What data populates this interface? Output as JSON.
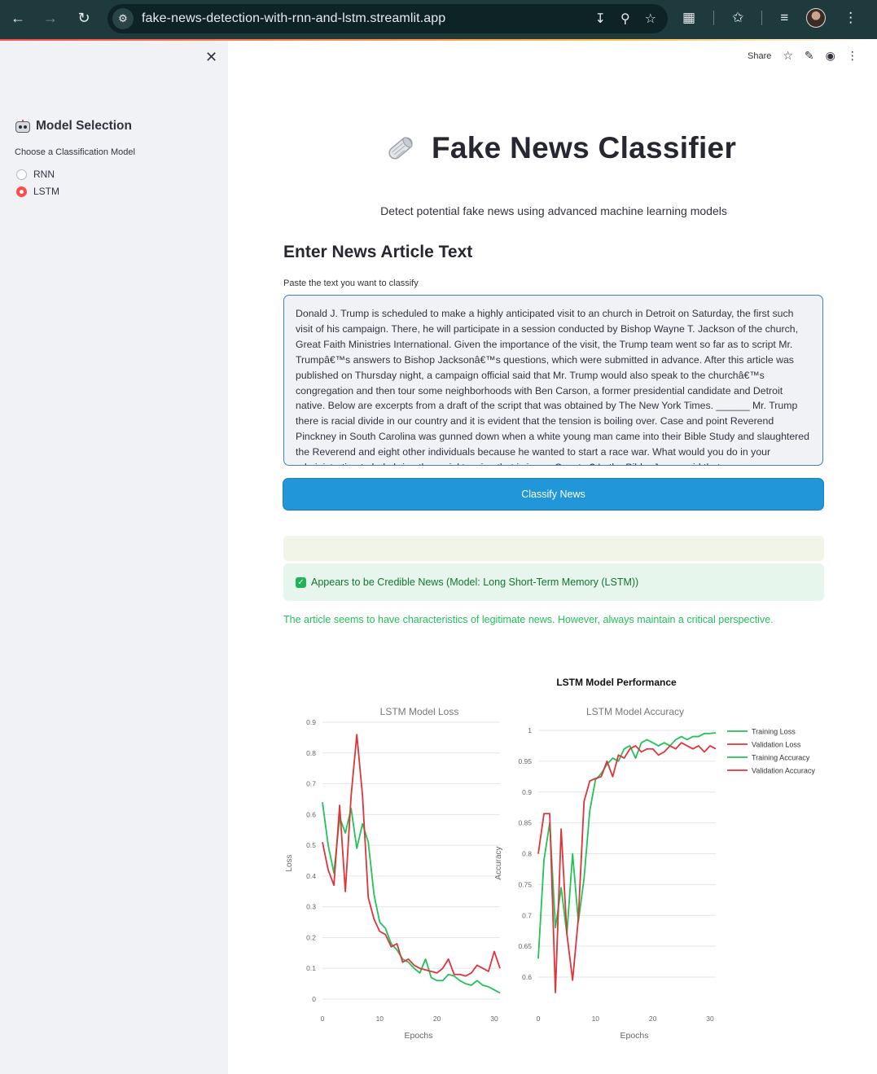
{
  "browser": {
    "url": "fake-news-detection-with-rnn-and-lstm.streamlit.app"
  },
  "toolbar": {
    "share_label": "Share"
  },
  "sidebar": {
    "title": "Model Selection",
    "radio_label": "Choose a Classification Model",
    "options": [
      {
        "label": "RNN",
        "selected": false
      },
      {
        "label": "LSTM",
        "selected": true
      }
    ]
  },
  "main": {
    "title": "Fake News Classifier",
    "subtitle": "Detect potential fake news using advanced machine learning models",
    "section_heading": "Enter News Article Text",
    "input_label": "Paste the text you want to classify",
    "article_text": "Donald J. Trump is scheduled to make a highly anticipated visit to an   church in Detroit on Saturday, the first such visit of his campaign. There, he will participate in a   session conducted by Bishop Wayne T. Jackson of the church, Great Faith Ministries International. Given the importance of the visit, the Trump team went so far as to script Mr. Trumpâ€™s answers to Bishop Jacksonâ€™s questions, which were submitted in advance. After this article was published on Thursday night, a campaign official said that Mr. Trump would also speak to the churchâ€™s congregation and then tour some neighborhoods with Ben Carson, a former presidential candidate and Detroit native. Below are excerpts from a draft of the script that was obtained by The New York Times. ______ Mr. Trump there is racial divide in our country and it is evident that the tension is boiling over. Case and point Reverend Pinckney in South Carolina was gunned down when a white young man came into their Bible Study and slaughtered the Reverend and eight other individuals because he wanted to start a race war. What would you do in your administration to help bring the racial tension that is in our Country? In the Bible, Jesus said that...",
    "classify_button": "Classify News",
    "result_label": "Appears to be Credible News (Model: Long Short-Term Memory (LSTM))",
    "result_note": "The article seems to have characteristics of legitimate news. However, always maintain a critical perspective."
  },
  "colors": {
    "train": "#21c35a",
    "val": "#e0343c",
    "accent": "#ff4b4b",
    "button": "#2196d8"
  },
  "chart_data": [
    {
      "type": "line",
      "suptitle": "LSTM Model Performance",
      "title": "LSTM Model Loss",
      "xlabel": "Epochs",
      "ylabel": "Loss",
      "xlim": [
        0,
        31
      ],
      "ylim": [
        0,
        0.9
      ],
      "yticks": [
        "0",
        "0.1",
        "0.2",
        "0.3",
        "0.4",
        "0.5",
        "0.6",
        "0.7",
        "0.8",
        "0.9"
      ],
      "xticks": [
        "0",
        "10",
        "20",
        "30"
      ],
      "x": [
        0,
        1,
        2,
        3,
        4,
        5,
        6,
        7,
        8,
        9,
        10,
        11,
        12,
        13,
        14,
        15,
        16,
        17,
        18,
        19,
        20,
        21,
        22,
        23,
        24,
        25,
        26,
        27,
        28,
        29,
        30,
        31
      ],
      "series": [
        {
          "name": "Training Loss",
          "values": [
            0.64,
            0.5,
            0.41,
            0.59,
            0.54,
            0.62,
            0.49,
            0.57,
            0.51,
            0.34,
            0.25,
            0.23,
            0.18,
            0.16,
            0.13,
            0.12,
            0.1,
            0.085,
            0.13,
            0.07,
            0.06,
            0.06,
            0.08,
            0.075,
            0.06,
            0.05,
            0.045,
            0.06,
            0.045,
            0.04,
            0.03,
            0.02
          ]
        },
        {
          "name": "Validation Loss",
          "values": [
            0.51,
            0.42,
            0.37,
            0.63,
            0.35,
            0.66,
            0.86,
            0.66,
            0.33,
            0.26,
            0.22,
            0.21,
            0.17,
            0.18,
            0.12,
            0.13,
            0.11,
            0.1,
            0.095,
            0.09,
            0.085,
            0.1,
            0.13,
            0.08,
            0.08,
            0.075,
            0.085,
            0.11,
            0.1,
            0.09,
            0.155,
            0.1
          ]
        }
      ]
    },
    {
      "type": "line",
      "title": "LSTM Model Accuracy",
      "xlabel": "Epochs",
      "ylabel": "Accuracy",
      "xlim": [
        0,
        31
      ],
      "ylim": [
        0.6,
        1.0
      ],
      "yticks": [
        "0.6",
        "0.65",
        "0.7",
        "0.75",
        "0.8",
        "0.85",
        "0.9",
        "0.95",
        "1"
      ],
      "xticks": [
        "0",
        "10",
        "20",
        "30"
      ],
      "x": [
        0,
        1,
        2,
        3,
        4,
        5,
        6,
        7,
        8,
        9,
        10,
        11,
        12,
        13,
        14,
        15,
        16,
        17,
        18,
        19,
        20,
        21,
        22,
        23,
        24,
        25,
        26,
        27,
        28,
        29,
        30,
        31
      ],
      "series": [
        {
          "name": "Training Accuracy",
          "values": [
            0.63,
            0.79,
            0.85,
            0.68,
            0.745,
            0.67,
            0.8,
            0.69,
            0.76,
            0.87,
            0.92,
            0.93,
            0.945,
            0.955,
            0.95,
            0.97,
            0.975,
            0.955,
            0.98,
            0.985,
            0.98,
            0.975,
            0.98,
            0.975,
            0.985,
            0.99,
            0.985,
            0.99,
            0.99,
            0.995,
            0.995,
            0.996
          ]
        },
        {
          "name": "Validation Accuracy",
          "values": [
            0.8,
            0.865,
            0.865,
            0.575,
            0.84,
            0.67,
            0.595,
            0.695,
            0.885,
            0.918,
            0.922,
            0.925,
            0.95,
            0.925,
            0.96,
            0.955,
            0.97,
            0.975,
            0.965,
            0.97,
            0.97,
            0.96,
            0.965,
            0.975,
            0.97,
            0.98,
            0.975,
            0.97,
            0.975,
            0.965,
            0.975,
            0.97
          ]
        }
      ],
      "legend_position": "right",
      "legend": [
        "Training Loss",
        "Validation Loss",
        "Training Accuracy",
        "Validation Accuracy"
      ]
    }
  ]
}
